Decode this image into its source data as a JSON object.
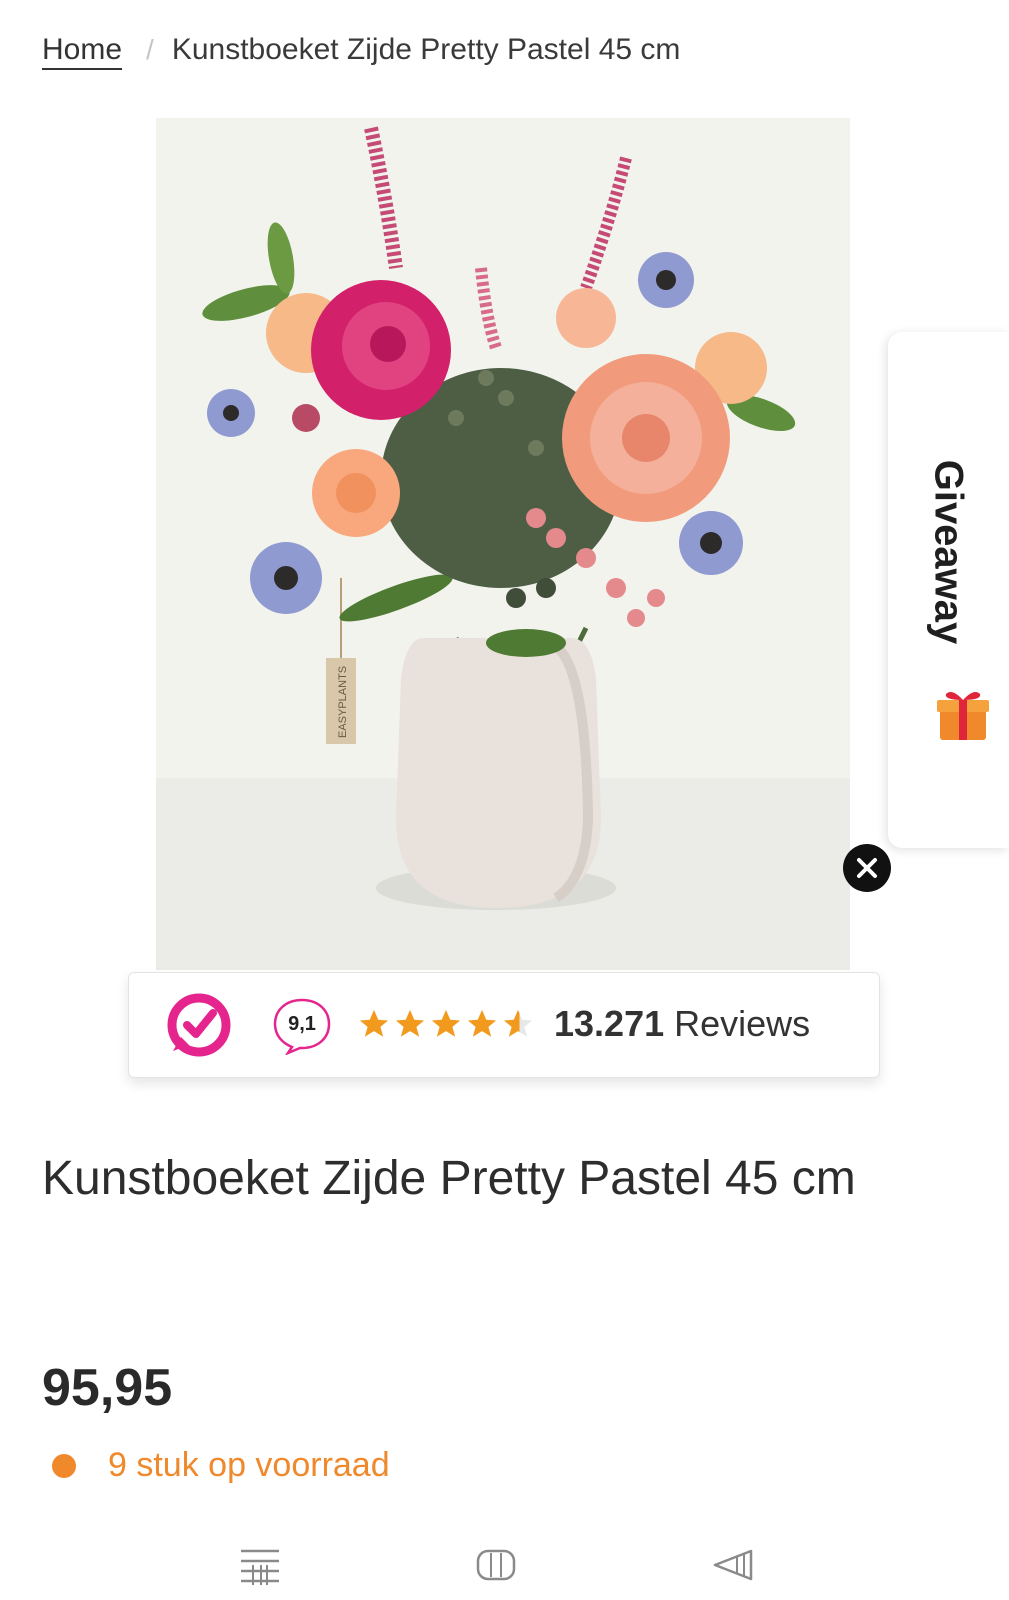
{
  "breadcrumb": {
    "home": "Home",
    "separator": "/",
    "current": "Kunstboeket Zijde Pretty Pastel 45 cm"
  },
  "product": {
    "image_label": "EASYPLANTS",
    "title": "Kunstboeket Zijde Pretty Pastel 45 cm",
    "price": "95,95",
    "stock": "9 stuk op voorraad"
  },
  "giveaway": {
    "label": "Giveaway",
    "icon": "gift-icon"
  },
  "reviews": {
    "logo": "kiyoh-logo",
    "score": "9,1",
    "stars": 4.5,
    "count": "13.271",
    "label": "Reviews"
  },
  "navbar": {
    "icons": [
      "menu-icon",
      "home-icon",
      "back-icon"
    ]
  },
  "colors": {
    "accent_orange": "#f0892b",
    "star_orange": "#f29a1d",
    "kiyoh_pink": "#e5248d"
  }
}
